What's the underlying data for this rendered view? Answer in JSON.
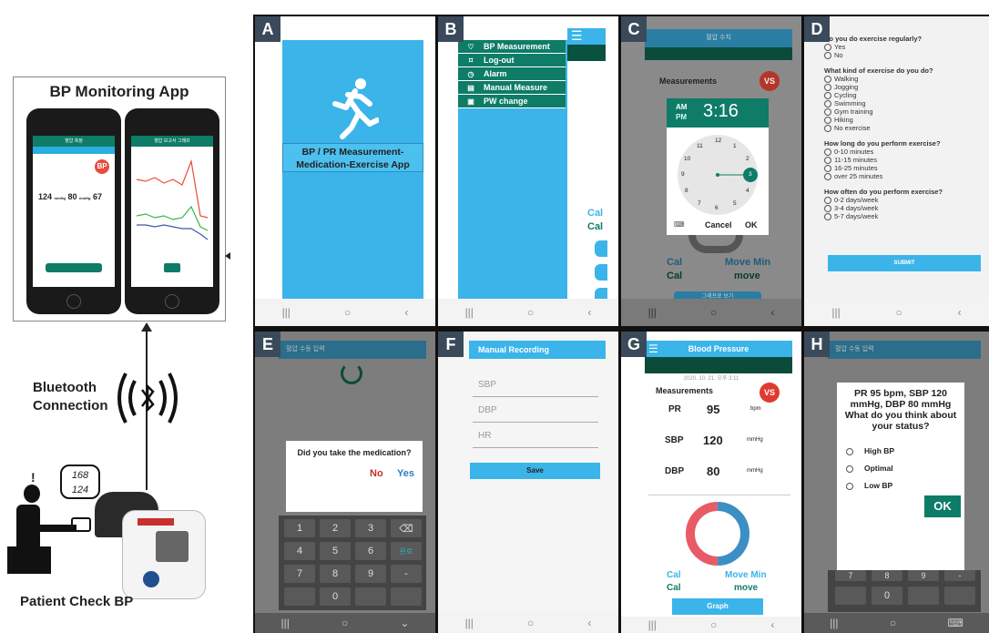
{
  "left": {
    "app_title": "BP Monitoring App",
    "bluetooth_label_line1": "Bluetooth",
    "bluetooth_label_line2": "Connection",
    "patient_label": "Patient Check BP",
    "bubble_top": "168",
    "bubble_bottom": "124",
    "phone1": {
      "title": "혈압 측정",
      "bp_badge": "BP",
      "sys": "124",
      "dia": "80",
      "pulse": "67"
    },
    "phone2": {
      "title": "혈압 보고서 그래프"
    }
  },
  "panelA": {
    "label": "A",
    "title_line1": "BP / PR Measurement-",
    "title_line2": "Medication-Exercise App"
  },
  "panelB": {
    "label": "B",
    "menu": [
      "BP Measurement",
      "Log-out",
      "Alarm",
      "Manual Measure",
      "PW change"
    ],
    "side_text1": "Cal",
    "side_text2": "Cal"
  },
  "panelC": {
    "label": "C",
    "header": "혈압 수치",
    "measurements": "Measurements",
    "vs": "VS",
    "am": "AM",
    "pm": "PM",
    "time": "3:16",
    "cancel": "Cancel",
    "ok": "OK",
    "cal1": "Cal",
    "cal2": "Cal",
    "move_min": "Move Min",
    "move": "move",
    "graph_btn": "그래프로 보기",
    "clock_numbers": [
      "12",
      "1",
      "2",
      "3",
      "4",
      "5",
      "6",
      "7",
      "8",
      "9",
      "10",
      "11"
    ]
  },
  "panelD": {
    "label": "D",
    "q1": "Do you do exercise regularly?",
    "q1_opts": [
      "Yes",
      "No"
    ],
    "q2": "What kind of exercise do you do?",
    "q2_opts": [
      "Walking",
      "Jogging",
      "Cycling",
      "Swimming",
      "Gym training",
      "Hiking",
      "No exercise"
    ],
    "q3": "How long do you perform exercise?",
    "q3_opts": [
      "0-10 minutes",
      "11-15 minutes",
      "16-25 minutes",
      "over 25 minutes"
    ],
    "q4": "How often do you perform exercise?",
    "q4_opts": [
      "0-2 days/week",
      "3-4 days/week",
      "5-7 days/week"
    ],
    "submit": "SUBMIT"
  },
  "panelE": {
    "label": "E",
    "header": "혈압 수동 입력",
    "question": "Did you take the medication?",
    "no": "No",
    "yes": "Yes",
    "keys": [
      "1",
      "2",
      "3",
      "⌫",
      "4",
      "5",
      "6",
      "완료",
      "7",
      "8",
      "9",
      "-",
      "",
      "0",
      "",
      ""
    ]
  },
  "panelF": {
    "label": "F",
    "header": "Manual Recording",
    "sbp": "SBP",
    "dbp": "DBP",
    "hr": "HR",
    "save": "Save"
  },
  "panelG": {
    "label": "G",
    "header": "Blood Pressure",
    "date": "2020. 10. 21. 오후 3:11",
    "measurements": "Measurements",
    "vs": "VS",
    "rows": [
      {
        "name": "PR",
        "value": "95",
        "unit": "bpm"
      },
      {
        "name": "SBP",
        "value": "120",
        "unit": "mmHg"
      },
      {
        "name": "DBP",
        "value": "80",
        "unit": "mmHg"
      }
    ],
    "cal1": "Cal",
    "cal2": "Cal",
    "move_min": "Move Min",
    "move": "move",
    "graph": "Graph"
  },
  "panelH": {
    "label": "H",
    "header": "혈압 수동 입력",
    "question": "PR 95 bpm, SBP 120 mmHg, DBP 80 mmHg What do you think about your status?",
    "options": [
      "High BP",
      "Optimal",
      "Low BP"
    ],
    "ok": "OK"
  }
}
